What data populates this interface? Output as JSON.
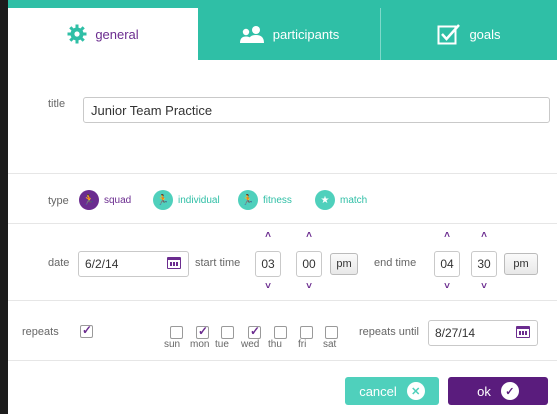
{
  "tabs": {
    "general": "general",
    "participants": "participants",
    "goals": "goals"
  },
  "title": {
    "label": "title",
    "value": "Junior Team Practice"
  },
  "type": {
    "label": "type",
    "options": [
      "squad",
      "individual",
      "fitness",
      "match"
    ],
    "selected": "squad"
  },
  "schedule": {
    "date_label": "date",
    "date_value": "6/2/14",
    "start_label": "start time",
    "start_hour": "03",
    "start_minute": "00",
    "start_ampm": "pm",
    "end_label": "end time",
    "end_hour": "04",
    "end_minute": "30",
    "end_ampm": "pm"
  },
  "repeats": {
    "label": "repeats",
    "checked": true,
    "days": [
      "sun",
      "mon",
      "tue",
      "wed",
      "thu",
      "fri",
      "sat"
    ],
    "days_checked": [
      false,
      true,
      false,
      true,
      false,
      false,
      false
    ],
    "until_label": "repeats until",
    "until_value": "8/27/14"
  },
  "buttons": {
    "cancel": "cancel",
    "ok": "ok"
  },
  "colors": {
    "teal": "#2fbfa6",
    "purple": "#6b2c8f",
    "dark_purple": "#5a1c7d"
  }
}
